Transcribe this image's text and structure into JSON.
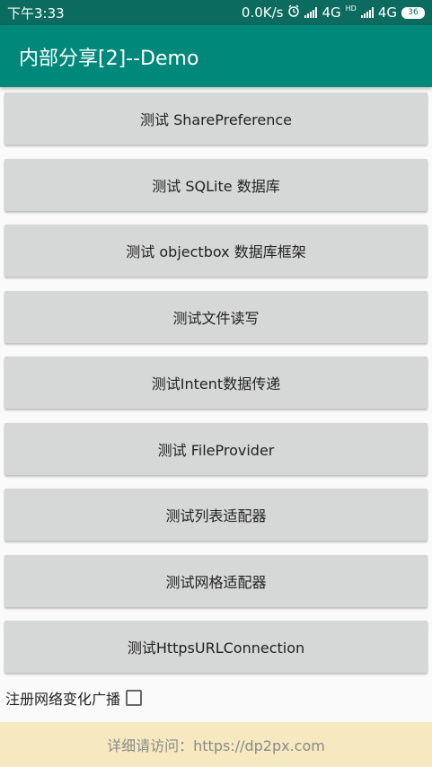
{
  "status_bar": {
    "time": "下午3:33",
    "network_speed": "0.0K/s",
    "signal1_label": "4G",
    "signal2_label": "4G",
    "signal2_badge": "HD",
    "battery": "36"
  },
  "app_bar": {
    "title": "内部分享[2]--Demo"
  },
  "buttons": [
    "测试 SharePreference",
    "测试 SQLite 数据库",
    "测试 objectbox 数据库框架",
    "测试文件读写",
    "测试Intent数据传递",
    "测试 FileProvider",
    "测试列表适配器",
    "测试网格适配器",
    "测试HttpsURLConnection"
  ],
  "checkbox": {
    "label": "注册网络变化广播",
    "checked": false
  },
  "footer": {
    "text": "详细请访问：https://dp2px.com"
  }
}
